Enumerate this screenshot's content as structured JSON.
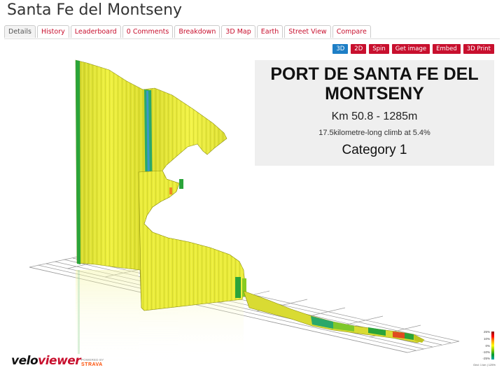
{
  "page": {
    "title": "Santa Fe del Montseny"
  },
  "tabs": [
    {
      "label": "Details",
      "active": true
    },
    {
      "label": "History",
      "active": false
    },
    {
      "label": "Leaderboard",
      "active": false
    },
    {
      "label": "0 Comments",
      "active": false
    },
    {
      "label": "Breakdown",
      "active": false
    },
    {
      "label": "3D Map",
      "active": false
    },
    {
      "label": "Earth",
      "active": false
    },
    {
      "label": "Street View",
      "active": false
    },
    {
      "label": "Compare",
      "active": false
    }
  ],
  "toolbar": {
    "buttons": [
      {
        "label": "3D",
        "active": true
      },
      {
        "label": "2D",
        "active": false
      },
      {
        "label": "Spin",
        "active": false
      },
      {
        "label": "Get image",
        "active": false
      },
      {
        "label": "Embed",
        "active": false
      },
      {
        "label": "3D Print",
        "active": false
      }
    ]
  },
  "climb": {
    "name": "PORT DE SANTA FE DEL MONTSENY",
    "km": "Km 50.8 - 1285m",
    "description": "17.5kilometre-long climb at 5.4%",
    "category": "Category 1"
  },
  "branding": {
    "logo_velo": "velo",
    "logo_viewer": "viewer",
    "strava_top": "POWERED BY",
    "strava_name": "STRAVA"
  },
  "legend": {
    "labels": [
      "25%",
      "10%",
      "0%",
      "-10%",
      "-25%"
    ],
    "footer": "Grid: 1 km | 125%"
  },
  "colors": {
    "accent": "#c8102e",
    "active_button": "#1e7fc6",
    "profile_fill": "#e6e832",
    "profile_green": "#2eaa3a",
    "strava": "#fc4c02"
  }
}
